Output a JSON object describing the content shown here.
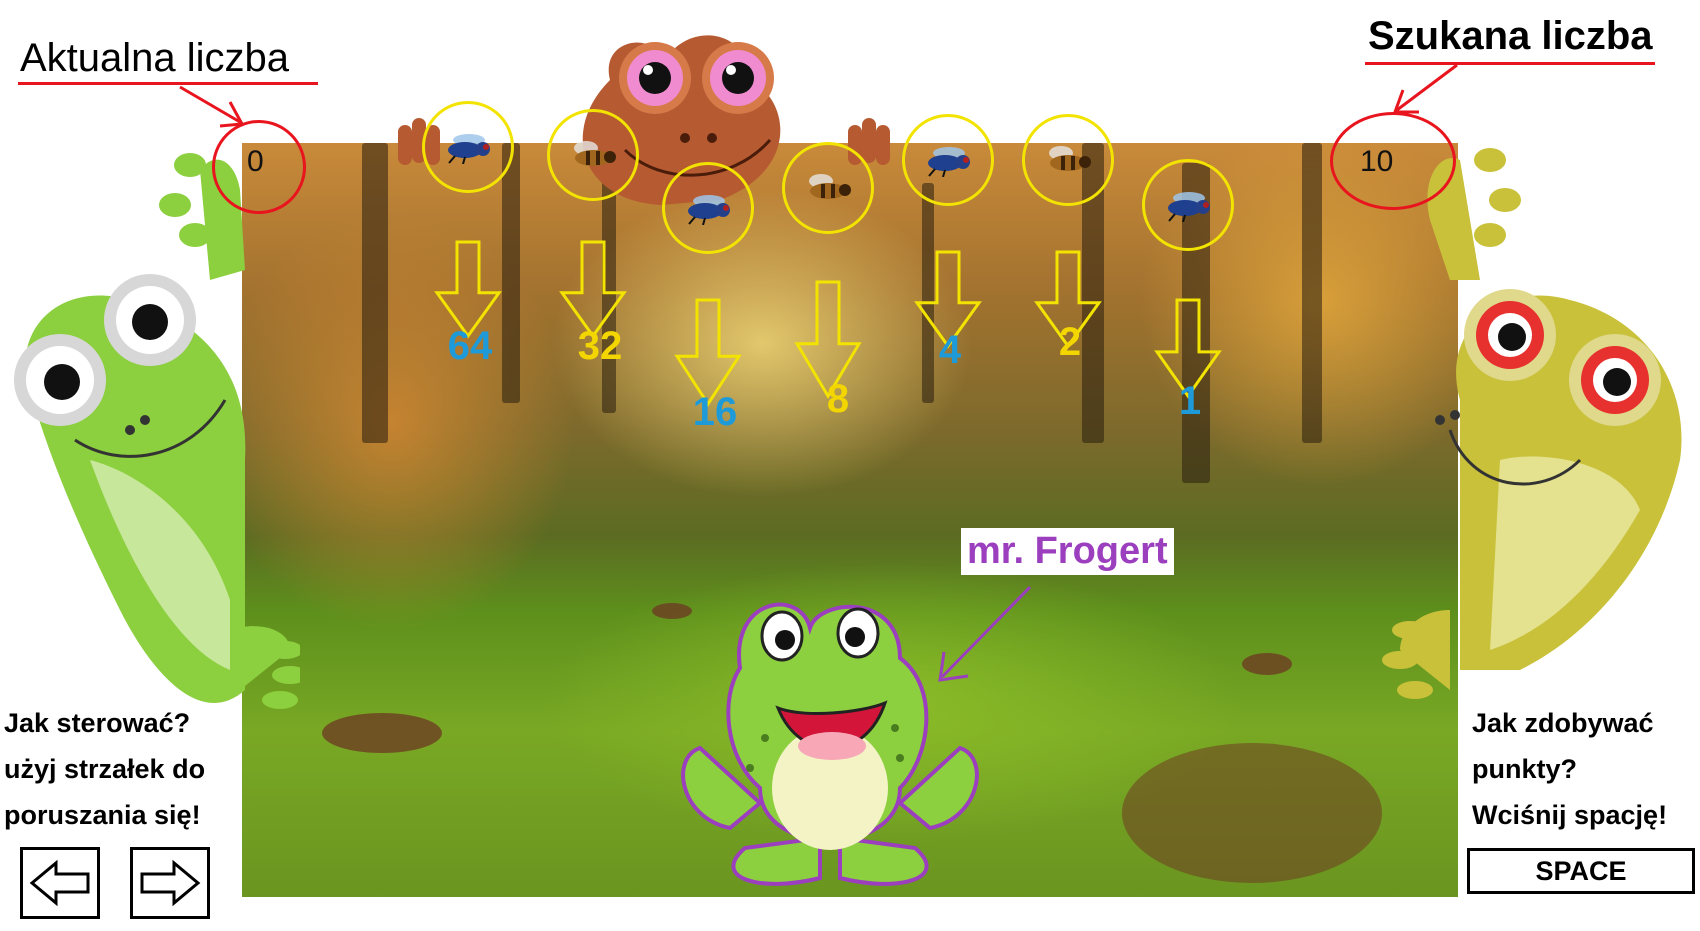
{
  "labels": {
    "current": "Aktualna liczba",
    "target": "Szukana liczba"
  },
  "counters": {
    "current_value": "0",
    "target_value": "10"
  },
  "flies": [
    {
      "value": "64",
      "kind": "fly",
      "color": "#1e9ad8"
    },
    {
      "value": "32",
      "kind": "bee",
      "color": "#f3d600"
    },
    {
      "value": "16",
      "kind": "fly",
      "color": "#1e9ad8"
    },
    {
      "value": "8",
      "kind": "bee",
      "color": "#f3d600"
    },
    {
      "value": "4",
      "kind": "fly",
      "color": "#1e9ad8"
    },
    {
      "value": "2",
      "kind": "bee",
      "color": "#f3d600"
    },
    {
      "value": "1",
      "kind": "fly",
      "color": "#1e9ad8"
    }
  ],
  "player": {
    "name": "mr. Frogert"
  },
  "help_left": {
    "line1": "Jak sterować?",
    "line2": "użyj strzałek do",
    "line3": "poruszania się!",
    "left_key": "left-arrow-icon",
    "right_key": "right-arrow-icon"
  },
  "help_right": {
    "line1": "Jak zdobywać",
    "line2": "punkty?",
    "line3": "Wciśnij spację!",
    "key": "SPACE"
  },
  "colors": {
    "accent_red": "#e8141e",
    "ring_yellow": "#f3e300",
    "blue_number": "#1e9ad8",
    "yellow_number": "#f3d600",
    "name_purple": "#9b3fbf"
  }
}
